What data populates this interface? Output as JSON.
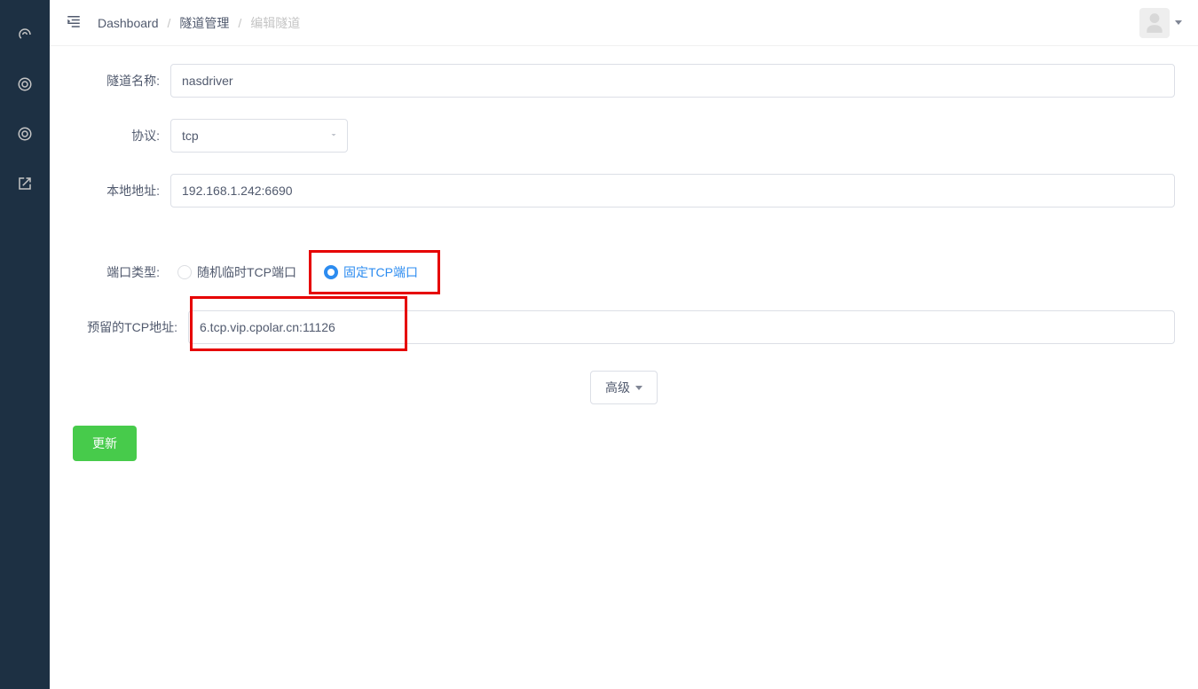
{
  "breadcrumb": {
    "dashboard": "Dashboard",
    "tunnel_manage": "隧道管理",
    "edit_tunnel": "编辑隧道"
  },
  "form": {
    "tunnel_name_label": "隧道名称:",
    "tunnel_name_value": "nasdriver",
    "protocol_label": "协议:",
    "protocol_value": "tcp",
    "local_address_label": "本地地址:",
    "local_address_value": "192.168.1.242:6690",
    "port_type_label": "端口类型:",
    "port_random_label": "随机临时TCP端口",
    "port_fixed_label": "固定TCP端口",
    "reserved_label": "预留的TCP地址:",
    "reserved_value": "6.tcp.vip.cpolar.cn:11126",
    "advanced_label": "高级",
    "submit_label": "更新"
  }
}
